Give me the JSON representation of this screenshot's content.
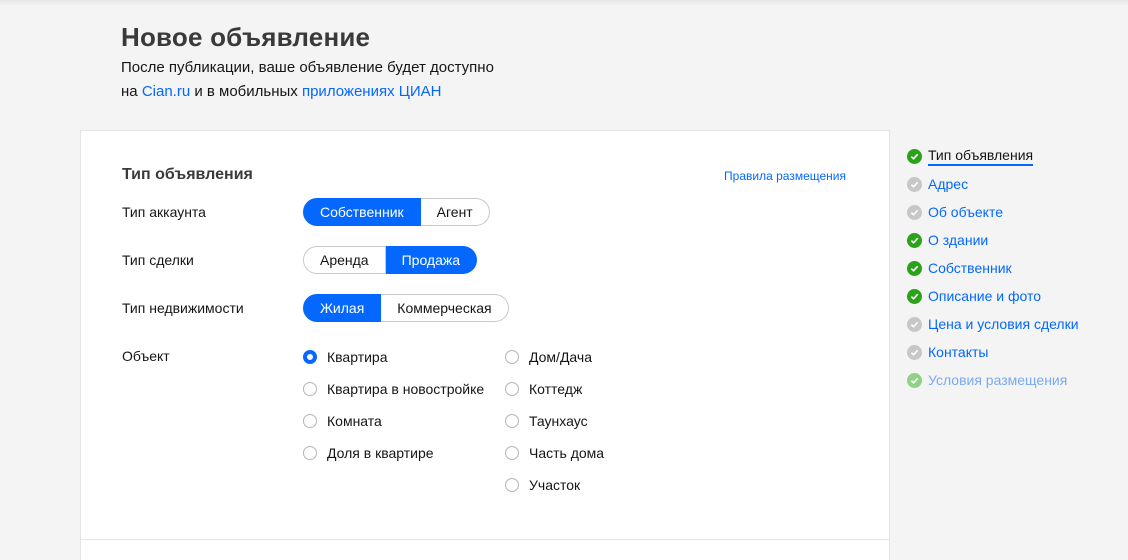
{
  "header": {
    "title": "Новое объявление",
    "subtitle_line1": "После публикации, ваше объявление будет доступно",
    "subtitle_prefix": "на",
    "cian_link": "Cian.ru",
    "subtitle_middle": "и в мобильных",
    "apps_link": "приложениях ЦИАН"
  },
  "form": {
    "section_title": "Тип объявления",
    "rules_link": "Правила размещения",
    "account_type": {
      "label": "Тип аккаунта",
      "options": [
        "Собственник",
        "Агент"
      ],
      "selected": "Собственник"
    },
    "deal_type": {
      "label": "Тип сделки",
      "options": [
        "Аренда",
        "Продажа"
      ],
      "selected": "Продажа"
    },
    "property_type": {
      "label": "Тип недвижимости",
      "options": [
        "Жилая",
        "Коммерческая"
      ],
      "selected": "Жилая"
    },
    "object": {
      "label": "Объект",
      "col1": [
        "Квартира",
        "Квартира в новостройке",
        "Комната",
        "Доля в квартире"
      ],
      "col2": [
        "Дом/Дача",
        "Коттедж",
        "Таунхаус",
        "Часть дома",
        "Участок"
      ],
      "selected": "Квартира"
    }
  },
  "nav": {
    "items": [
      {
        "label": "Тип объявления",
        "status": "done",
        "current": true
      },
      {
        "label": "Адрес",
        "status": "todo"
      },
      {
        "label": "Об объекте",
        "status": "todo"
      },
      {
        "label": "О здании",
        "status": "done"
      },
      {
        "label": "Собственник",
        "status": "done"
      },
      {
        "label": "Описание и фото",
        "status": "done"
      },
      {
        "label": "Цена и условия сделки",
        "status": "todo"
      },
      {
        "label": "Контакты",
        "status": "todo"
      },
      {
        "label": "Условия размещения",
        "status": "done-light",
        "faded": true
      }
    ]
  },
  "colors": {
    "accent": "#0468ff",
    "done": "#2ea11c",
    "todo": "#c7c7c7"
  }
}
